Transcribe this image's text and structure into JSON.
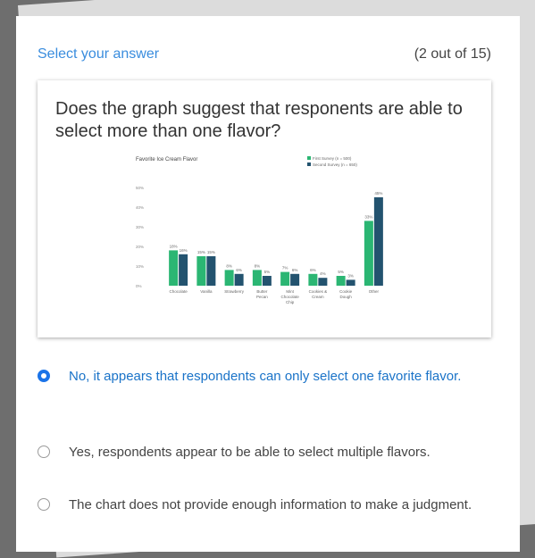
{
  "header": {
    "prompt": "Select your answer",
    "progress": "(2 out of 15)"
  },
  "question": {
    "text": "Does the graph suggest that responents are able to select more than one flavor?"
  },
  "options": [
    {
      "label": "No, it appears that respondents can only select one favorite flavor.",
      "selected": true
    },
    {
      "label": "Yes, respondents appear to be able to select multiple flavors.",
      "selected": false
    },
    {
      "label": "The chart does not provide enough information to make a judgment.",
      "selected": false
    }
  ],
  "chart_data": {
    "type": "bar",
    "title": "Favorite Ice Cream Flavor",
    "categories": [
      "Chocolate",
      "Vanilla",
      "Strawberry",
      "Butter Pecan",
      "Mint Chocolate Chip",
      "Cookies & Cream",
      "Cookie Dough",
      "Other"
    ],
    "category_lines": [
      [
        "Chocolate"
      ],
      [
        "Vanilla"
      ],
      [
        "Strawberry"
      ],
      [
        "Butter",
        "Pecan"
      ],
      [
        "Mint",
        "Chocolate",
        "Chip"
      ],
      [
        "Cookies &",
        "Cream"
      ],
      [
        "Cookie",
        "Dough"
      ],
      [
        "Other"
      ]
    ],
    "series": [
      {
        "name": "First Survey (n = 500)",
        "values": [
          18,
          15,
          8,
          8,
          7,
          6,
          5,
          33
        ],
        "color": "#2bb673"
      },
      {
        "name": "Second Survey (n = 650)",
        "values": [
          16,
          15,
          6,
          5,
          6,
          4,
          3,
          45
        ],
        "color": "#23536f"
      }
    ],
    "ylim": [
      0,
      50
    ],
    "yticks": [
      "0%",
      "10%",
      "20%",
      "30%",
      "40%",
      "50%"
    ],
    "legend_position": "top-right",
    "grid": false
  }
}
